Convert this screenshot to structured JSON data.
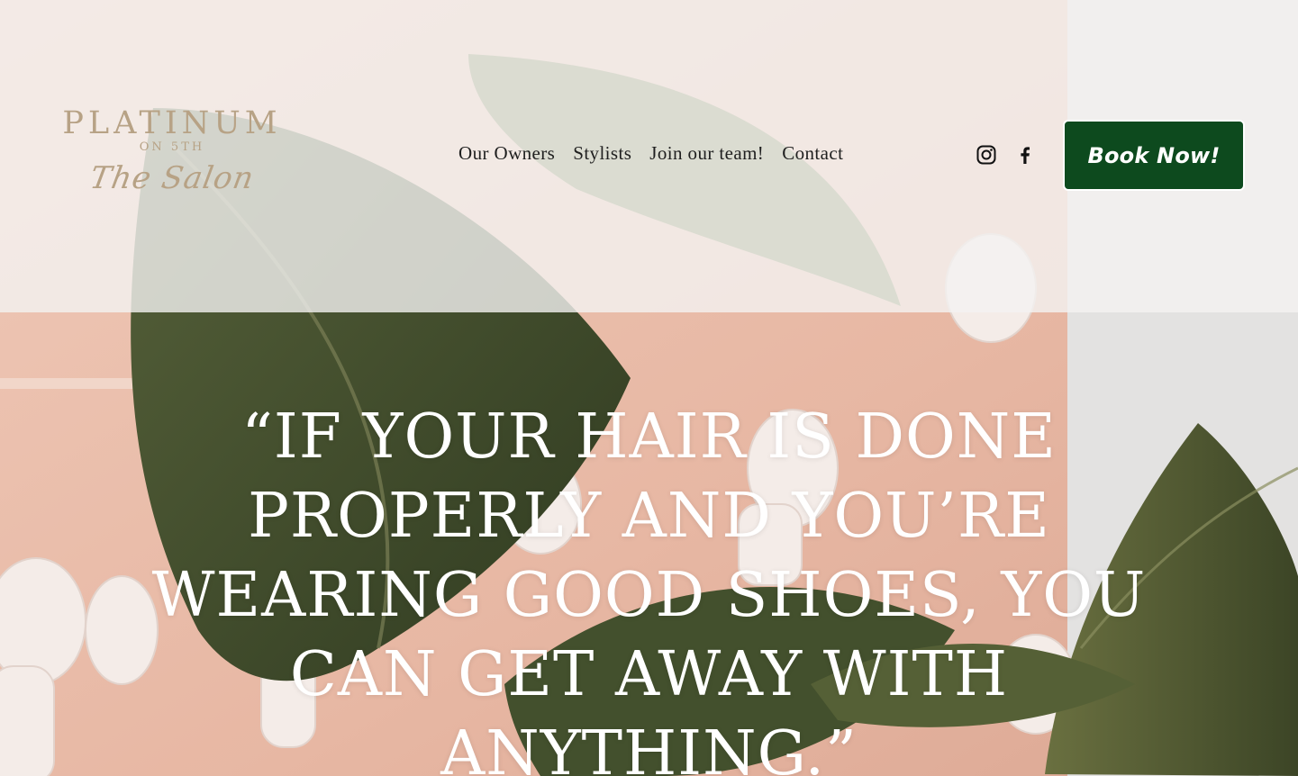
{
  "logo": {
    "brand": "PLATINUM",
    "sub": "ON 5TH",
    "script": "The Salon"
  },
  "nav": {
    "items": [
      {
        "label": "Our Owners"
      },
      {
        "label": "Stylists"
      },
      {
        "label": "Join our team!"
      },
      {
        "label": "Contact"
      }
    ]
  },
  "social": {
    "instagram_icon": "instagram-icon",
    "facebook_icon": "facebook-icon"
  },
  "cta": {
    "label": "Book Now!",
    "color": "#0d4a1e"
  },
  "hero": {
    "quote": "“If your hair is done properly and you’re wearing good shoes, you can get away with anything.”"
  },
  "colors": {
    "logo": "#b7a285",
    "wall": "#e8bfae",
    "leaf": "#3f4a2a"
  }
}
